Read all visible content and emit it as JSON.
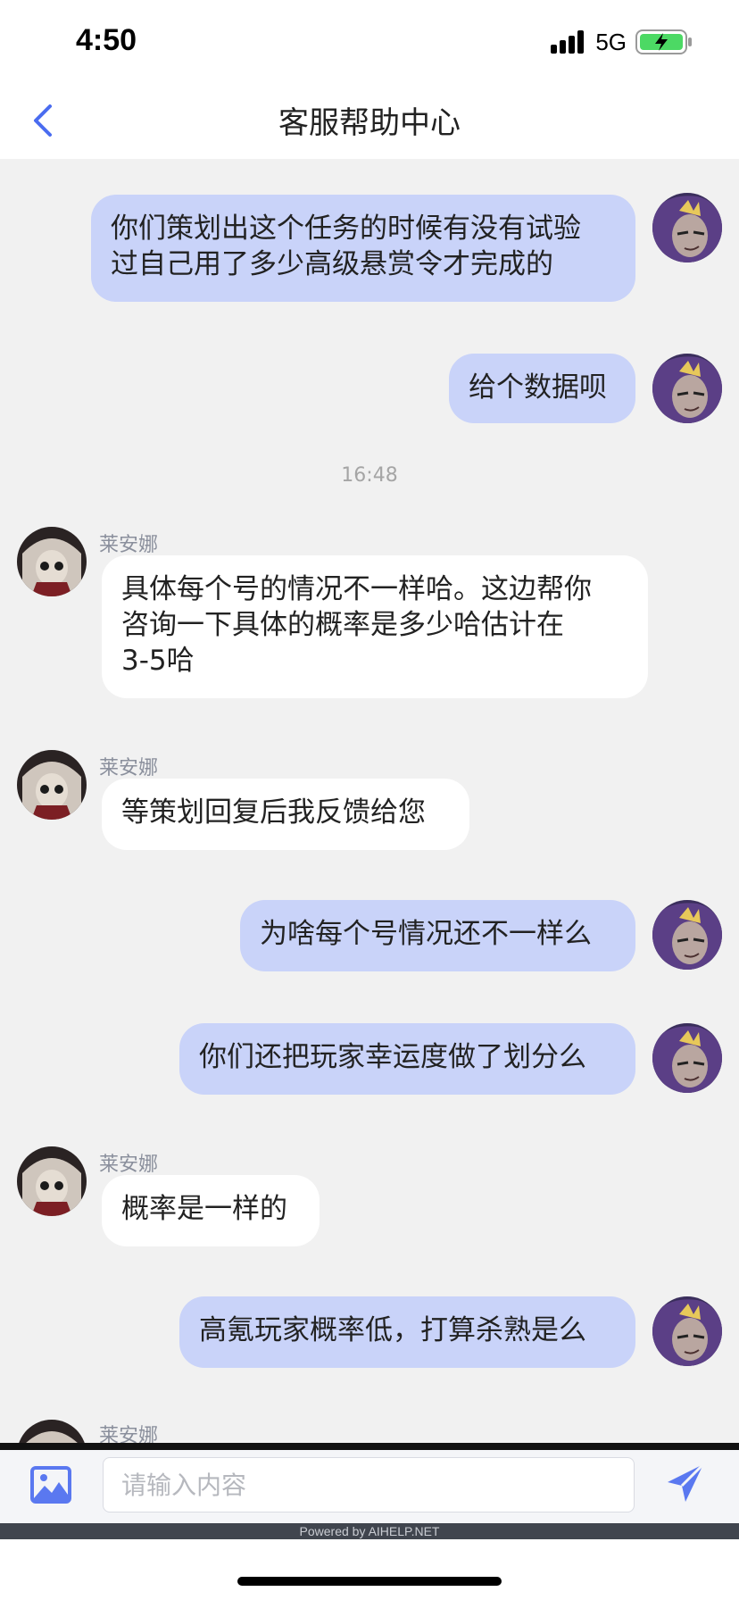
{
  "status": {
    "time": "4:50",
    "network": "5G",
    "battery_color": "#4cd964"
  },
  "nav": {
    "title": "客服帮助中心",
    "back_icon": "chevron-left-icon",
    "accent": "#4a6cf0"
  },
  "messages": [
    {
      "kind": "user",
      "text_lines": [
        "你们策划出这个任务的时候有没有试验",
        "过自己用了多少高级悬赏令才完成的"
      ]
    },
    {
      "kind": "user",
      "text_lines": [
        "给个数据呗"
      ]
    },
    {
      "kind": "timestamp",
      "text": "16:48"
    },
    {
      "kind": "agent",
      "sender": "莱安娜",
      "text_lines": [
        "具体每个号的情况不一样哈。这边帮你",
        "咨询一下具体的概率是多少哈估计在",
        "3-5哈"
      ]
    },
    {
      "kind": "agent",
      "sender": "莱安娜",
      "text_lines": [
        "等策划回复后我反馈给您"
      ]
    },
    {
      "kind": "user",
      "text_lines": [
        "为啥每个号情况还不一样么"
      ]
    },
    {
      "kind": "user",
      "text_lines": [
        "你们还把玩家幸运度做了划分么"
      ]
    },
    {
      "kind": "agent",
      "sender": "莱安娜",
      "text_lines": [
        "概率是一样的"
      ]
    },
    {
      "kind": "user",
      "text_lines": [
        "高氪玩家概率低，打算杀熟是么"
      ]
    },
    {
      "kind": "agent",
      "sender": "莱安娜",
      "text_lines": []
    }
  ],
  "input": {
    "placeholder": "请输入内容",
    "value": "",
    "image_icon": "image-icon",
    "send_icon": "send-icon"
  },
  "footer": {
    "powered_by": "Powered by AIHELP.NET"
  },
  "colors": {
    "user_bubble": "#c9d3f9",
    "agent_bubble": "#ffffff",
    "background": "#f1f1f1"
  }
}
